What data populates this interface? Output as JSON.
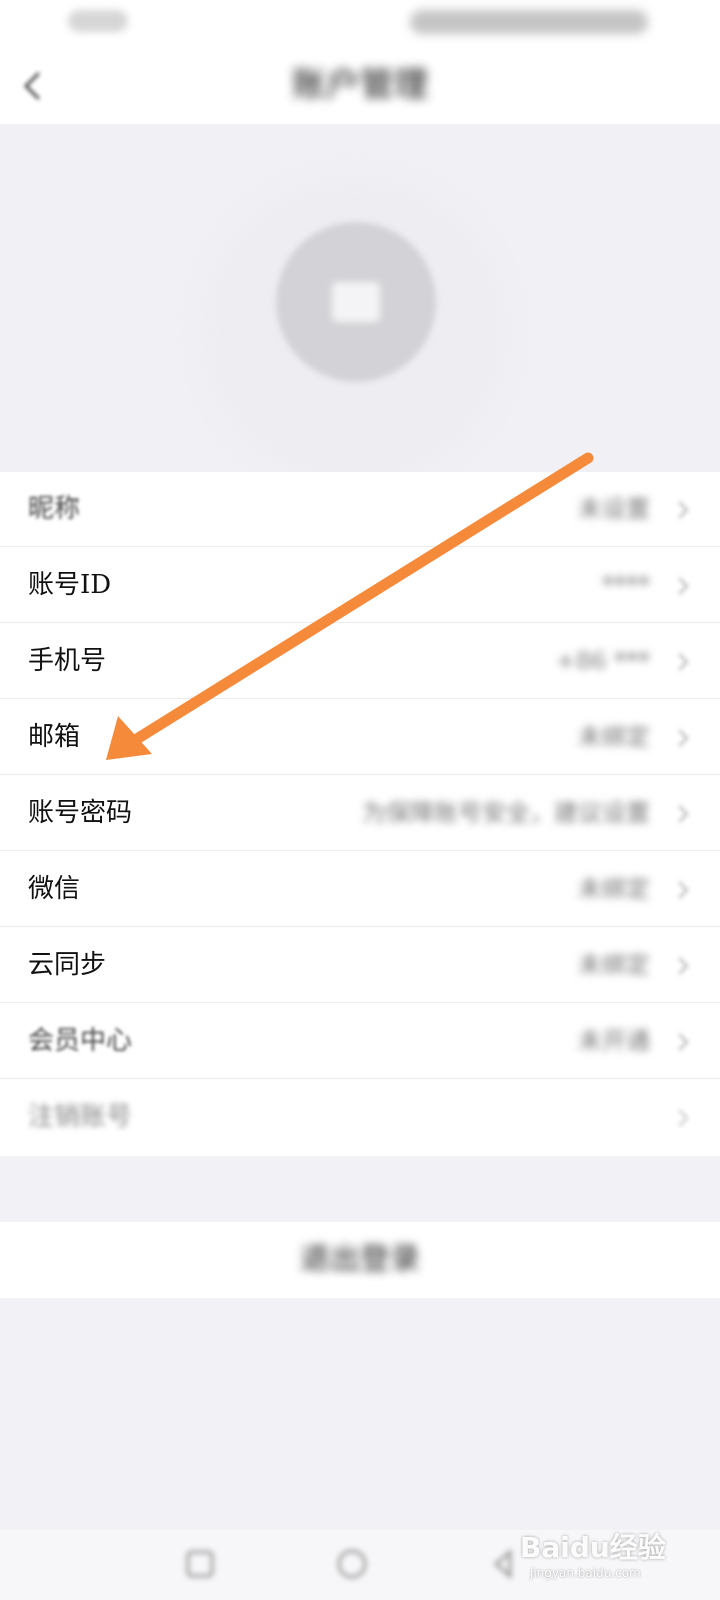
{
  "header": {
    "title": "账户管理"
  },
  "list": {
    "rows": [
      {
        "label": "昵称",
        "value": "未设置"
      },
      {
        "label": "账号ID",
        "value": "****"
      },
      {
        "label": "手机号",
        "value": "+86 ***"
      },
      {
        "label": "邮箱",
        "value": "未绑定"
      },
      {
        "label": "账号密码",
        "value": "为保障账号安全，建议设置"
      },
      {
        "label": "微信",
        "value": "未绑定"
      },
      {
        "label": "云同步",
        "value": "未绑定"
      },
      {
        "label": "会员中心",
        "value": "未开通"
      },
      {
        "label": "注销账号",
        "value": ""
      }
    ]
  },
  "footer": {
    "logout_label": "退出登录"
  },
  "watermark": {
    "brand": "Baidu经验",
    "url": "jingyan.baidu.com"
  },
  "colors": {
    "annotation_arrow": "#f58a3a",
    "page_background": "#f2f2f6"
  },
  "icons": {
    "back": "back-arrow-icon",
    "row_chevron": "chevron-right-icon",
    "avatar": "image-icon"
  }
}
